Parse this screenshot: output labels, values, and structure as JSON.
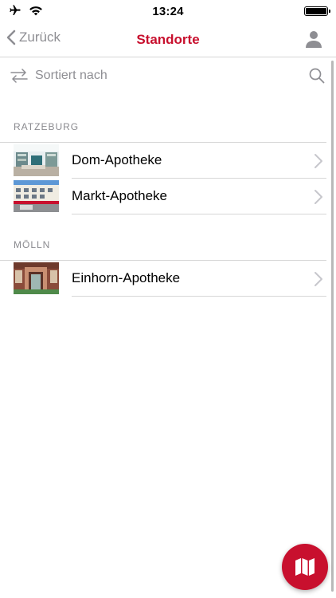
{
  "status_bar": {
    "time": "13:24"
  },
  "nav": {
    "back_label": "Zurück",
    "title": "Standorte"
  },
  "sort": {
    "label": "Sortiert nach"
  },
  "sections": [
    {
      "header": "RATZEBURG",
      "items": [
        {
          "name": "Dom-Apotheke"
        },
        {
          "name": "Markt-Apotheke"
        }
      ]
    },
    {
      "header": "MÖLLN",
      "items": [
        {
          "name": "Einhorn-Apotheke"
        }
      ]
    }
  ],
  "colors": {
    "accent": "#c8102e",
    "secondary_text": "#8e8e93",
    "separator": "#d6d6d6"
  },
  "icons": [
    "airplane-icon",
    "wifi-icon",
    "battery-icon",
    "chevron-left-icon",
    "person-icon",
    "sort-arrows-icon",
    "search-icon",
    "chevron-right-icon",
    "map-icon"
  ]
}
